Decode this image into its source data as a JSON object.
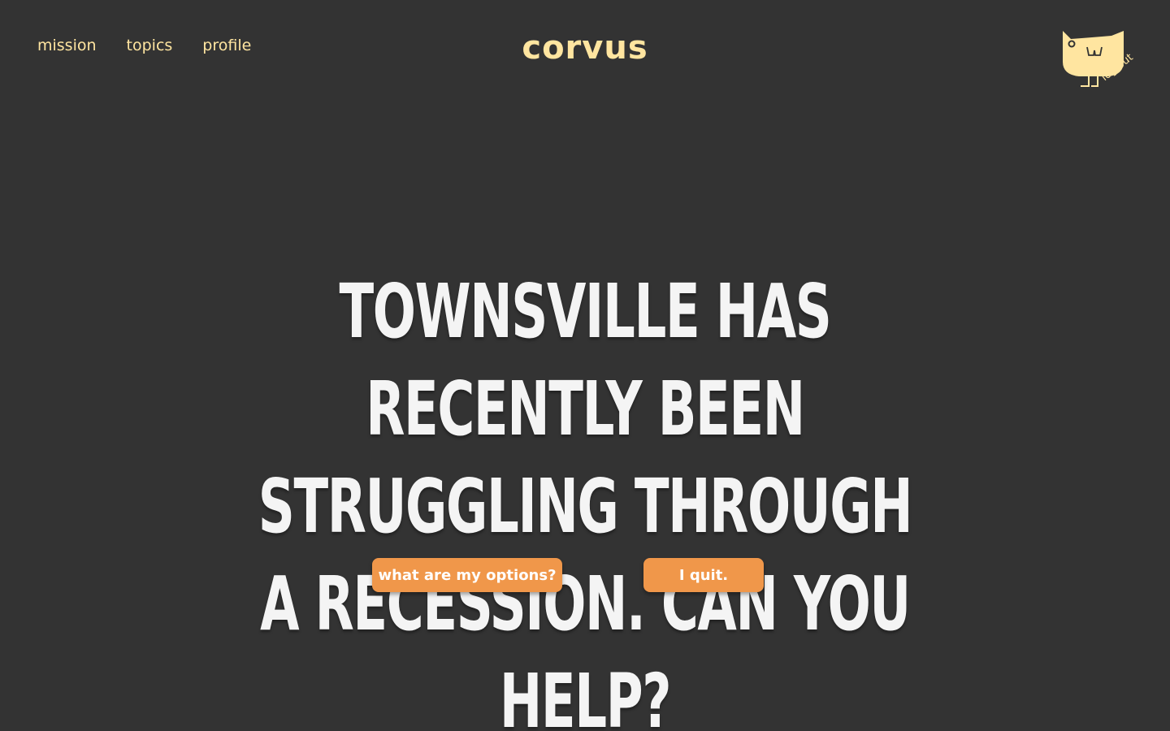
{
  "nav": {
    "items": [
      {
        "label": "mission"
      },
      {
        "label": "topics"
      },
      {
        "label": "profile"
      }
    ]
  },
  "brand": {
    "title": "corvus"
  },
  "account": {
    "mascot_icon": "bird-mascot-icon",
    "logout_label": "log out"
  },
  "main": {
    "headline": "Townsville has recently been struggling through a recession. Can you help?",
    "actions": {
      "options_label": "what are my options?",
      "quit_label": "I quit."
    }
  },
  "colors": {
    "background": "#333333",
    "accent_text": "#ffe5a0",
    "headline": "#f4f4f4",
    "button": "#f0974a",
    "button_text": "#ffffff"
  }
}
